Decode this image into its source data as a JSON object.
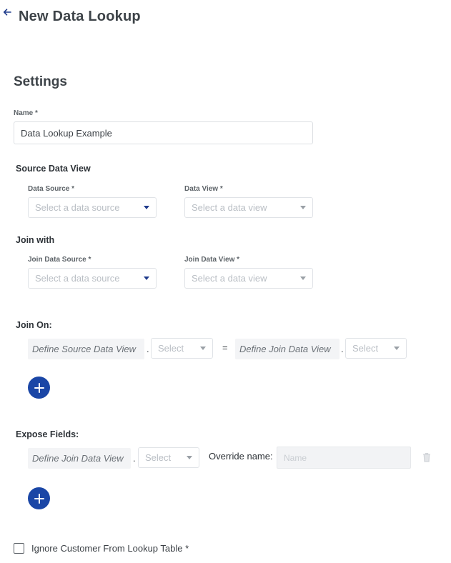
{
  "header": {
    "back_icon": "arrow-left-icon",
    "title": "New Data Lookup"
  },
  "settings": {
    "title": "Settings",
    "name_label": "Name *",
    "name_value": "Data Lookup Example"
  },
  "source": {
    "title": "Source Data View",
    "data_source_label": "Data Source *",
    "data_source_placeholder": "Select a data source",
    "data_view_label": "Data View *",
    "data_view_placeholder": "Select a data view"
  },
  "join_with": {
    "title": "Join with",
    "join_data_source_label": "Join Data Source *",
    "join_data_source_placeholder": "Select a data source",
    "join_data_view_label": "Join Data View *",
    "join_data_view_placeholder": "Select a data view"
  },
  "join_on": {
    "title": "Join On:",
    "define_source": "Define Source Data View",
    "dot": ".",
    "select_placeholder": "Select",
    "equals": "=",
    "define_join": "Define Join Data View",
    "select_placeholder_2": "Select"
  },
  "expose": {
    "title": "Expose Fields:",
    "define_join": "Define Join Data View",
    "dot": ".",
    "select_placeholder": "Select",
    "override_label": "Override name:",
    "name_placeholder": "Name"
  },
  "ignore_customer": {
    "label": "Ignore Customer From Lookup Table *",
    "checked": false
  },
  "colors": {
    "accent": "#1a46a6",
    "title": "#3d4348",
    "placeholder": "#b9bec4"
  }
}
